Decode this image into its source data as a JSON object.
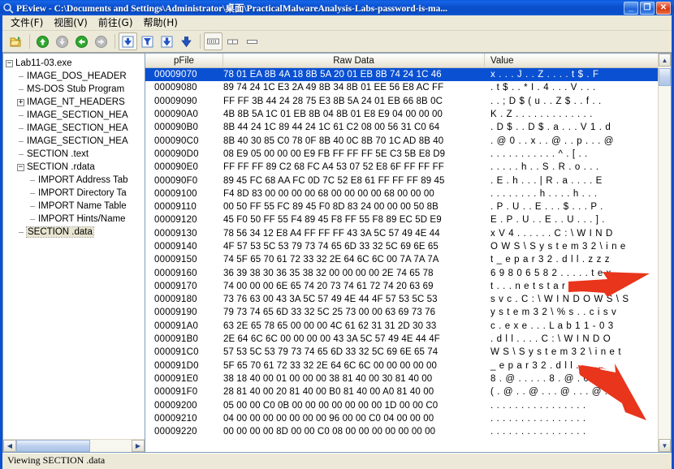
{
  "window": {
    "title": "PEview - C:\\Documents and Settings\\Administrator\\桌面\\PracticalMalwareAnalysis-Labs-password-is-ma...",
    "app_icon": "magnifier-icon",
    "minimize_label": "_",
    "maximize_label": "❐",
    "close_label": "✕",
    "title_bar_color": "#0a50d2",
    "client_color": "#ece9d8"
  },
  "menu": {
    "items": [
      {
        "label": "文件(F)",
        "name": "menu-file"
      },
      {
        "label": "视图(V)",
        "name": "menu-view"
      },
      {
        "label": "前往(G)",
        "name": "menu-goto"
      },
      {
        "label": "帮助(H)",
        "name": "menu-help"
      }
    ]
  },
  "toolbar": {
    "buttons": [
      {
        "name": "open-file-button",
        "icon": "open-folder-icon",
        "framed": false,
        "enabled": true
      },
      {
        "name": "nav-up-button",
        "icon": "arrow-up-circle-icon",
        "framed": false,
        "enabled": true
      },
      {
        "name": "nav-down-button",
        "icon": "arrow-down-circle-icon",
        "framed": false,
        "enabled": false
      },
      {
        "name": "nav-back-button",
        "icon": "arrow-left-circle-icon",
        "framed": false,
        "enabled": true
      },
      {
        "name": "nav-forward-button",
        "icon": "arrow-right-circle-icon",
        "framed": false,
        "enabled": false
      },
      {
        "name": "view-hex-button",
        "icon": "down-arrow-box-icon",
        "framed": true,
        "enabled": true
      },
      {
        "name": "view-filter-button",
        "icon": "funnel-box-icon",
        "framed": false,
        "enabled": true
      },
      {
        "name": "view-struct-button",
        "icon": "down-arrow-box2-icon",
        "framed": false,
        "enabled": true
      },
      {
        "name": "view-dump-button",
        "icon": "down-arrow-plain-icon",
        "framed": false,
        "enabled": true
      },
      {
        "name": "show-full-columns-button",
        "icon": "columns-wide-icon",
        "framed": true,
        "enabled": true
      },
      {
        "name": "show-two-columns-button",
        "icon": "columns-two-icon",
        "framed": false,
        "enabled": true
      },
      {
        "name": "show-one-column-button",
        "icon": "columns-one-icon",
        "framed": false,
        "enabled": true
      }
    ]
  },
  "tree": {
    "nodes": [
      {
        "label": "Lab11-03.exe",
        "depth": 0,
        "toggle": "minus",
        "selected": false
      },
      {
        "label": "IMAGE_DOS_HEADER",
        "depth": 1,
        "toggle": "leaf",
        "selected": false
      },
      {
        "label": "MS-DOS Stub Program",
        "depth": 1,
        "toggle": "leaf",
        "selected": false
      },
      {
        "label": "IMAGE_NT_HEADERS",
        "depth": 1,
        "toggle": "plus",
        "selected": false
      },
      {
        "label": "IMAGE_SECTION_HEA",
        "depth": 1,
        "toggle": "leaf",
        "selected": false
      },
      {
        "label": "IMAGE_SECTION_HEA",
        "depth": 1,
        "toggle": "leaf",
        "selected": false
      },
      {
        "label": "IMAGE_SECTION_HEA",
        "depth": 1,
        "toggle": "leaf",
        "selected": false
      },
      {
        "label": "SECTION .text",
        "depth": 1,
        "toggle": "leaf",
        "selected": false
      },
      {
        "label": "SECTION .rdata",
        "depth": 1,
        "toggle": "minus",
        "selected": false
      },
      {
        "label": "IMPORT Address Tab",
        "depth": 2,
        "toggle": "leaf",
        "selected": false
      },
      {
        "label": "IMPORT Directory Ta",
        "depth": 2,
        "toggle": "leaf",
        "selected": false
      },
      {
        "label": "IMPORT Name Table",
        "depth": 2,
        "toggle": "leaf",
        "selected": false
      },
      {
        "label": "IMPORT Hints/Name",
        "depth": 2,
        "toggle": "leaf",
        "selected": false
      },
      {
        "label": "SECTION .data",
        "depth": 1,
        "toggle": "leaf",
        "selected": true
      }
    ]
  },
  "hex_view": {
    "columns": [
      {
        "label": "pFile",
        "name": "column-header-pfile"
      },
      {
        "label": "Raw Data",
        "name": "column-header-raw-data"
      },
      {
        "label": "Value",
        "name": "column-header-value"
      }
    ],
    "selected_offset": "00009070",
    "rows": [
      {
        "offset": "00009070",
        "raw": "78 01 EA 8B 4A 18 8B 5A   20 01 EB 8B 74 24 1C 46",
        "value": "x . . . J . . Z . . . . t $ . F",
        "selected": true
      },
      {
        "offset": "00009080",
        "raw": "89 74 24 1C E3 2A 49 8B   34 8B 01 EE 56 E8 AC FF",
        "value": ". t $ . . * I . 4 . . . V . . .",
        "selected": false
      },
      {
        "offset": "00009090",
        "raw": "FF FF 3B 44 24 28 75 E3   8B 5A 24 01 EB 66 8B 0C",
        "value": ". . ; D $ ( u . . Z $ . . f . .",
        "selected": false
      },
      {
        "offset": "000090A0",
        "raw": "4B 8B 5A 1C 01 EB 8B 04   8B 01 E8 E9 04 00 00 00",
        "value": "K . Z . . . . . . . . . . . . .",
        "selected": false
      },
      {
        "offset": "000090B0",
        "raw": "8B 44 24 1C 89 44 24 1C   61 C2 08 00 56 31 C0 64",
        "value": ". D $ . . D $ . a . . . V 1 . d",
        "selected": false
      },
      {
        "offset": "000090C0",
        "raw": "8B 40 30 85 C0 78 0F 8B   40 0C 8B 70 1C AD 8B 40",
        "value": ". @ 0 . . x . . @ . . p . . . @",
        "selected": false
      },
      {
        "offset": "000090D0",
        "raw": "08 E9 05 00 00 00 E9 FB   FF FF FF 5E C3 5B E8 D9",
        "value": ". . . . . . . . . . . ^ . [ . .",
        "selected": false
      },
      {
        "offset": "000090E0",
        "raw": "FF FF FF 89 C2 68 FC A4   53 07 52 E8 6F FF FF FF",
        "value": ". . . . . h . . S . R . o . . .",
        "selected": false
      },
      {
        "offset": "000090F0",
        "raw": "89 45 FC 68 AA FC 0D 7C   52 E8 61 FF FF FF 89 45",
        "value": ". E . h . . . | R . a . . . . E",
        "selected": false
      },
      {
        "offset": "00009100",
        "raw": "F4 8D 83 00 00 00 00 68   00 00 00 00 68 00 00 00",
        "value": ". . . . . . . . h . . . . h . . .",
        "selected": false
      },
      {
        "offset": "00009110",
        "raw": "00 50 FF 55 FC 89 45 F0   8D 83 24 00 00 00 50 8B",
        "value": ". P . U . . E . . . $ . . . P .",
        "selected": false
      },
      {
        "offset": "00009120",
        "raw": "45 F0 50 FF 55 F4 89 45   F8 FF 55 F8 89 EC 5D E9",
        "value": "E . P . U . . E . . U . . . ] .",
        "selected": false
      },
      {
        "offset": "00009130",
        "raw": "78 56 34 12 E8 A4 FF FF   FF 43 3A 5C 57 49 4E 44",
        "value": "x V 4 . . . . . . C : \\ W I N D",
        "selected": false
      },
      {
        "offset": "00009140",
        "raw": "4F 57 53 5C 53 79 73 74   65 6D 33 32 5C 69 6E 65",
        "value": "O W S \\ S y s t e m 3 2 \\ i n e",
        "selected": false
      },
      {
        "offset": "00009150",
        "raw": "74 5F 65 70 61 72 33 32   2E 64 6C 6C 00 7A 7A 7A",
        "value": "t _ e p a r 3 2 . d l l . z z z",
        "selected": false
      },
      {
        "offset": "00009160",
        "raw": "36 39 38 30 36 35 38 32   00 00 00 00 2E 74 65 78",
        "value": "6 9 8 0 6 5 8 2 . . . . . t e x",
        "selected": false
      },
      {
        "offset": "00009170",
        "raw": "74 00 00 00 6E 65 74 20   73 74 61 72 74 20 63 69",
        "value": "t . . . n e t   s t a r t   c i",
        "selected": false
      },
      {
        "offset": "00009180",
        "raw": "73 76 63 00 43 3A 5C 57   49 4E 44 4F 57 53 5C 53",
        "value": "s v c . C : \\ W I N D O W S \\ S",
        "selected": false
      },
      {
        "offset": "00009190",
        "raw": "79 73 74 65 6D 33 32 5C   25 73 00 00 63 69 73 76",
        "value": "y s t e m 3 2 \\ % s . . c i s v",
        "selected": false
      },
      {
        "offset": "000091A0",
        "raw": "63 2E 65 78 65 00 00 00   4C 61 62 31 31 2D 30 33",
        "value": "c . e x e . . . L a b 1 1 - 0 3",
        "selected": false
      },
      {
        "offset": "000091B0",
        "raw": "2E 64 6C 6C 00 00 00 00   43 3A 5C 57 49 4E 44 4F",
        "value": ". d l l . . . . C : \\ W I N D O",
        "selected": false
      },
      {
        "offset": "000091C0",
        "raw": "57 53 5C 53 79 73 74 65   6D 33 32 5C 69 6E 65 74",
        "value": "W S \\ S y s t e m 3 2 \\ i n e t",
        "selected": false
      },
      {
        "offset": "000091D0",
        "raw": "5F 65 70 61 72 33 32 2E   64 6C 6C 00 00 00 00 00",
        "value": "_ e p a r 3 2 . d l l . . . . .",
        "selected": false
      },
      {
        "offset": "000091E0",
        "raw": "38 18 40 00 01 00 00 00   38 81 40 00 30 81 40 00",
        "value": "8 . @ . . . . . 8 . @ . 0 . @ .",
        "selected": false
      },
      {
        "offset": "000091F0",
        "raw": "28 81 40 00 20 81 40 00   B0 81 40 00 A0 81 40 00",
        "value": "( . @ .   . @ . . . @ . . . @ .",
        "selected": false
      },
      {
        "offset": "00009200",
        "raw": "05 00 00 C0 0B 00 00 00   00 00 00 00 1D 00 00 C0",
        "value": ". . . . . . . . . . . . . . . .",
        "selected": false
      },
      {
        "offset": "00009210",
        "raw": "04 00 00 00 00 00 00 00   96 00 00 C0 04 00 00 00",
        "value": ". . . . . . . . . . . . . . . .",
        "selected": false
      },
      {
        "offset": "00009220",
        "raw": "00 00 00 00 8D 00 00 C0   08 00 00 00 00 00 00 00",
        "value": ". . . . . . . . . . . . . . . .",
        "selected": false
      }
    ]
  },
  "status": {
    "text": "Viewing SECTION .data"
  },
  "annotations": [
    {
      "name": "arrow-annotation-net-start",
      "color": "#e8351c",
      "target_row": "00009170"
    },
    {
      "name": "arrow-annotation-epar32-dll",
      "color": "#e8351c",
      "target_row": "000091D0"
    }
  ]
}
